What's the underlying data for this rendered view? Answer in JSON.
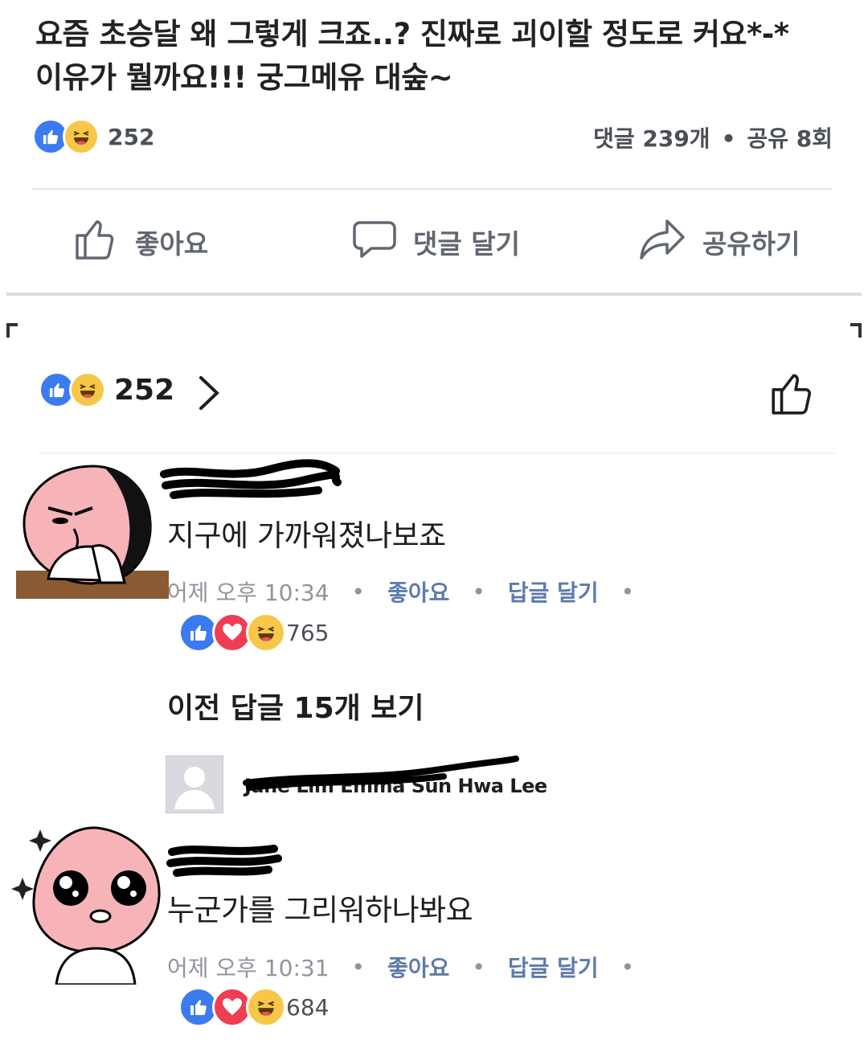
{
  "post": {
    "text_line1": "요즘 초승달 왜 그렇게 크죠..? 진짜로 괴이할 정도로 커요*-*",
    "text_line2": "이유가 뭘까요!!! 궁그메유 대숲~",
    "reaction_count": "252",
    "comments_count": "댓글 239개",
    "shares_count": "공유 8회",
    "separator": "•"
  },
  "actions": {
    "like_label": "좋아요",
    "comment_label": "댓글 달기",
    "share_label": "공유하기"
  },
  "comments_header": {
    "reaction_count": "252"
  },
  "comments": [
    {
      "text": "지구에 가까워졌나보죠",
      "time": "어제 오후 10:34",
      "like_link": "좋아요",
      "reply_link": "답글 달기",
      "separator": "•",
      "reaction_count": "765"
    },
    {
      "text": "누군가를 그리워하나봐요",
      "time": "어제 오후 10:31",
      "like_link": "좋아요",
      "reply_link": "답글 달기",
      "separator": "•",
      "reaction_count": "684"
    }
  ],
  "replies": {
    "view_previous": "이전 답글 15개 보기",
    "preview_names": "Jane Lim Emma Sun Hwa Lee"
  },
  "colors": {
    "like_blue": "#3b7bef",
    "haha_yellow": "#f7c74a",
    "love_red": "#ee3e53",
    "link_blue": "#5d7aaa",
    "meta_gray": "#90949c"
  },
  "icons": [
    "like-icon",
    "haha-icon",
    "love-icon",
    "thumbs-up-outline-icon",
    "comment-bubble-icon",
    "share-arrow-icon",
    "chevron-right-icon",
    "default-avatar-icon"
  ]
}
